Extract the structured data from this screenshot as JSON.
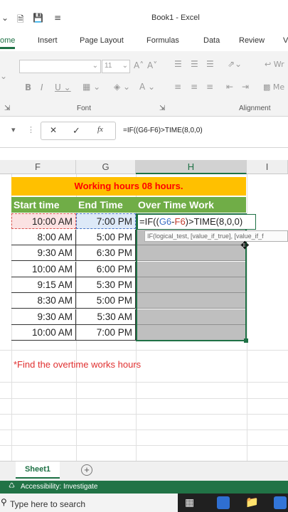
{
  "window": {
    "title": "Book1 - Excel"
  },
  "ribbon_tabs": [
    "ome",
    "Insert",
    "Page Layout",
    "Formulas",
    "Data",
    "Review",
    "V"
  ],
  "active_tab": "ome",
  "ribbon": {
    "font_size": "11",
    "group_font": "Font",
    "group_alignment": "Alignment",
    "wrap_partial": "Wr",
    "merge_partial": "Me",
    "grow_font": "A˄",
    "shrink_font": "A˅"
  },
  "formula_bar": {
    "cancel": "✕",
    "enter": "✓",
    "fx": "fx",
    "formula": "=IF((G6-F6)>TIME(8,0,0)"
  },
  "columns": [
    "F",
    "G",
    "H",
    "I"
  ],
  "sheet": {
    "banner": "Working hours 08 hours.",
    "headers": [
      "Start time",
      "End Time",
      "Over Time Work"
    ],
    "rows": [
      [
        "10:00 AM",
        "7:00 PM"
      ],
      [
        "8:00 AM",
        "5:00 PM"
      ],
      [
        "9:30 AM",
        "6:30 PM"
      ],
      [
        "10:00 AM",
        "6:00 PM"
      ],
      [
        "9:15 AM",
        "5:30 PM"
      ],
      [
        "8:30 AM",
        "5:00 PM"
      ],
      [
        "9:30 AM",
        "5:30 AM"
      ],
      [
        "10:00 AM",
        "7:00 PM"
      ]
    ],
    "edit_prefix": "=IF((",
    "edit_ref1": "G6",
    "edit_op": "-",
    "edit_ref2": "F6",
    "edit_suffix": ")>TIME(8,0,0)",
    "tooltip": "IF(logical_test, [value_if_true], [value_if_f",
    "note": "*Find the overtime works hours"
  },
  "sheet_tabs": {
    "active": "Sheet1",
    "add": "+"
  },
  "status": {
    "accessibility": "Accessibility: Investigate"
  },
  "taskbar": {
    "search_placeholder": "Type here to search"
  },
  "colors": {
    "excel_green": "#217346",
    "banner_bg": "#ffc000",
    "header_bg": "#70ad47",
    "selection_grey": "#bfbfbf"
  }
}
